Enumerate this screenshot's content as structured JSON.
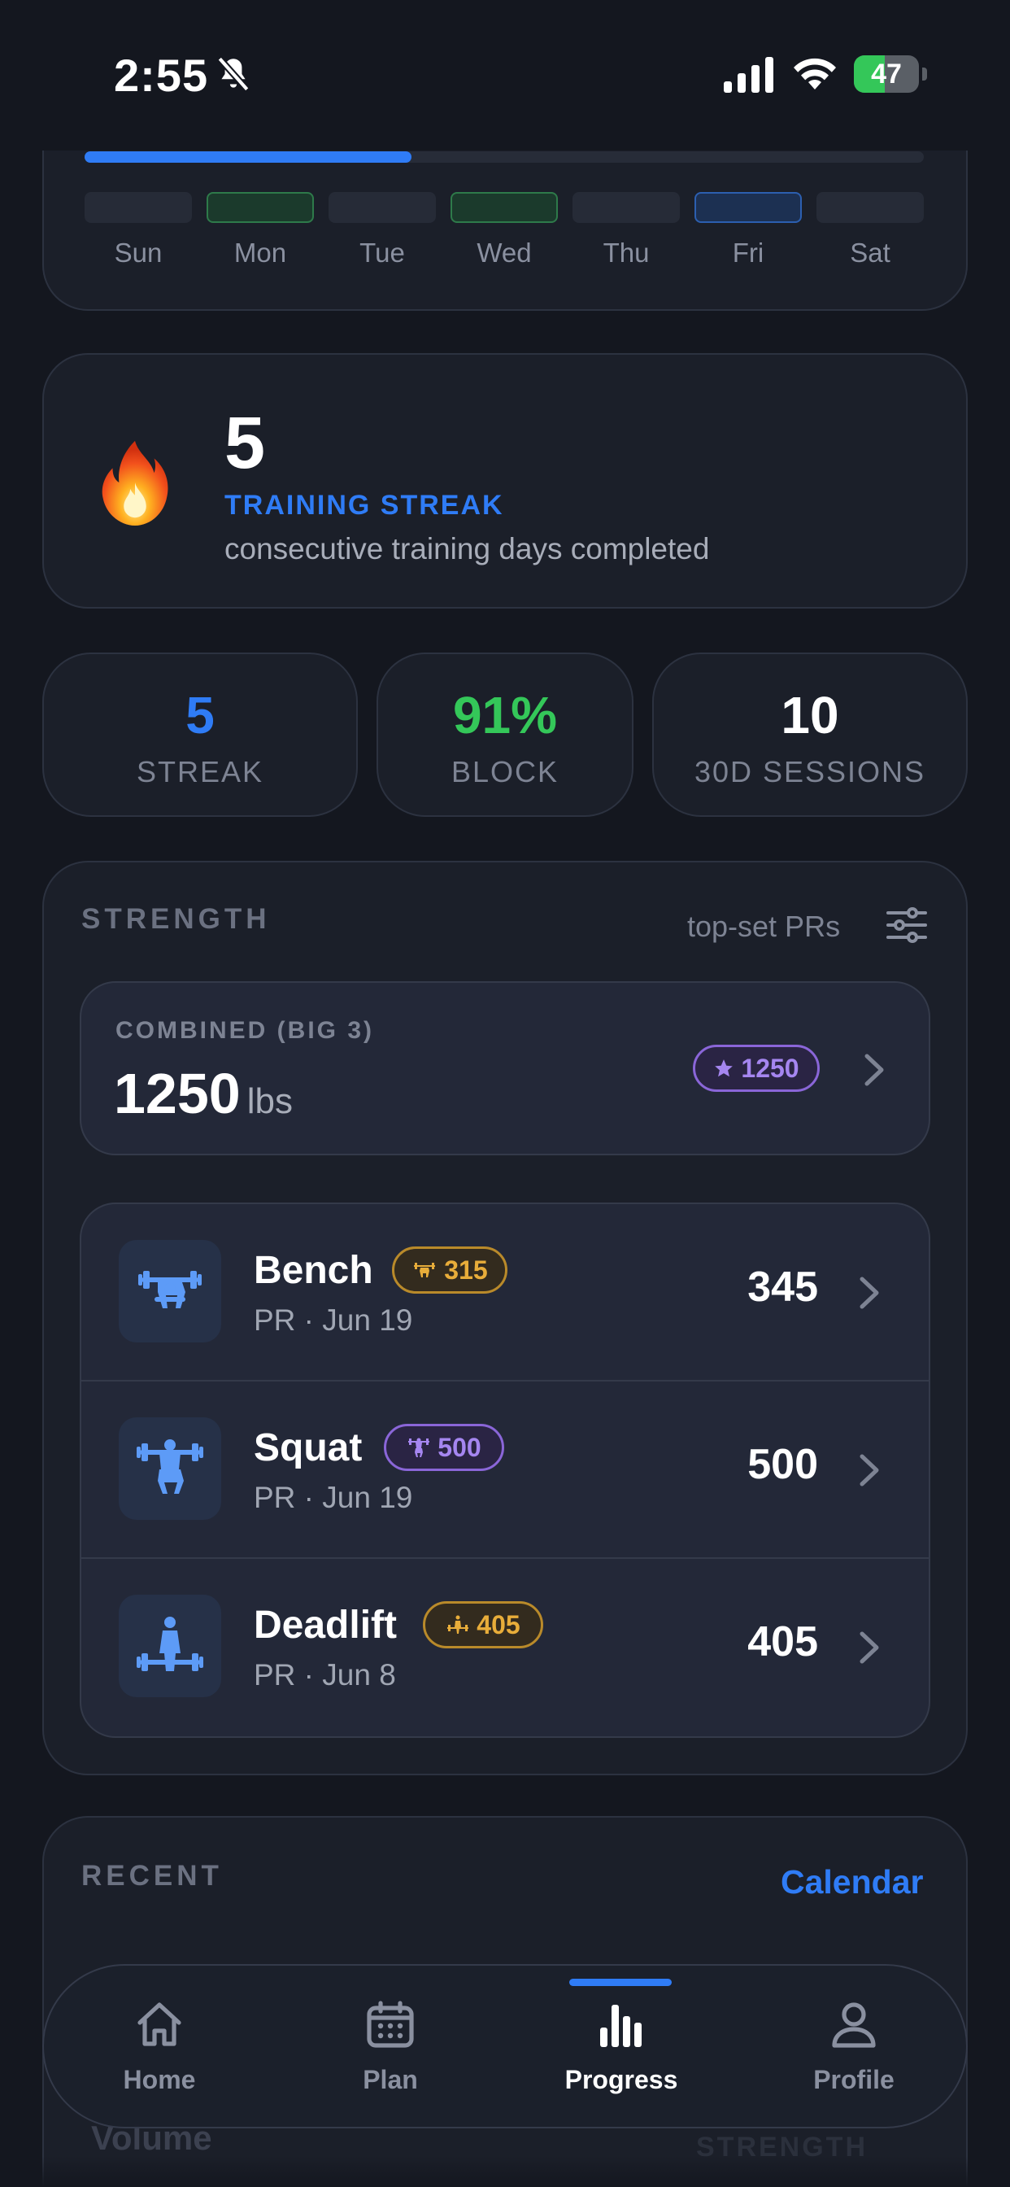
{
  "status_bar": {
    "time": "2:55",
    "battery": "47"
  },
  "week": {
    "progress_pct": 0.39,
    "days": [
      "Sun",
      "Mon",
      "Tue",
      "Wed",
      "Thu",
      "Fri",
      "Sat"
    ],
    "completed_days": [
      "Mon",
      "Wed"
    ],
    "today": "Fri"
  },
  "streak_card": {
    "value": "5",
    "title": "TRAINING STREAK",
    "subtitle": "consecutive training days completed"
  },
  "stats": [
    {
      "value": "5",
      "label": "STREAK",
      "color": "#2f7cf6"
    },
    {
      "value": "91%",
      "label": "BLOCK",
      "color": "#34c759"
    },
    {
      "value": "10",
      "label": "30D SESSIONS",
      "color": "#ffffff"
    }
  ],
  "strength": {
    "title": "STRENGTH",
    "filter_label": "top-set PRs",
    "combined": {
      "label": "COMBINED (BIG 3)",
      "value": "1250",
      "unit": "lbs",
      "badge": "1250"
    },
    "lifts": [
      {
        "name": "Bench",
        "badge": "315",
        "badge_color": "gold",
        "pr_date": "PR · Jun 19",
        "value": "345",
        "icon": "bench-press-icon"
      },
      {
        "name": "Squat",
        "badge": "500",
        "badge_color": "purple",
        "pr_date": "PR · Jun 19",
        "value": "500",
        "icon": "squat-icon"
      },
      {
        "name": "Deadlift",
        "badge": "405",
        "badge_color": "gold",
        "pr_date": "PR · Jun 8",
        "value": "405",
        "icon": "deadlift-icon"
      }
    ]
  },
  "recent": {
    "title": "RECENT",
    "calendar_link": "Calendar",
    "peek_left": "Volume",
    "peek_right": "STRENGTH"
  },
  "tabs": [
    {
      "label": "Home",
      "icon": "home-icon"
    },
    {
      "label": "Plan",
      "icon": "calendar-icon"
    },
    {
      "label": "Progress",
      "icon": "bar-chart-icon",
      "active": true
    },
    {
      "label": "Profile",
      "icon": "person-icon"
    }
  ],
  "colors": {
    "accent": "#2f7cf6",
    "success": "#34c759",
    "pr_gold": "#e8ad3a",
    "pr_purple": "#a586f0",
    "background": "#14171f",
    "card": "#1b1f29"
  }
}
